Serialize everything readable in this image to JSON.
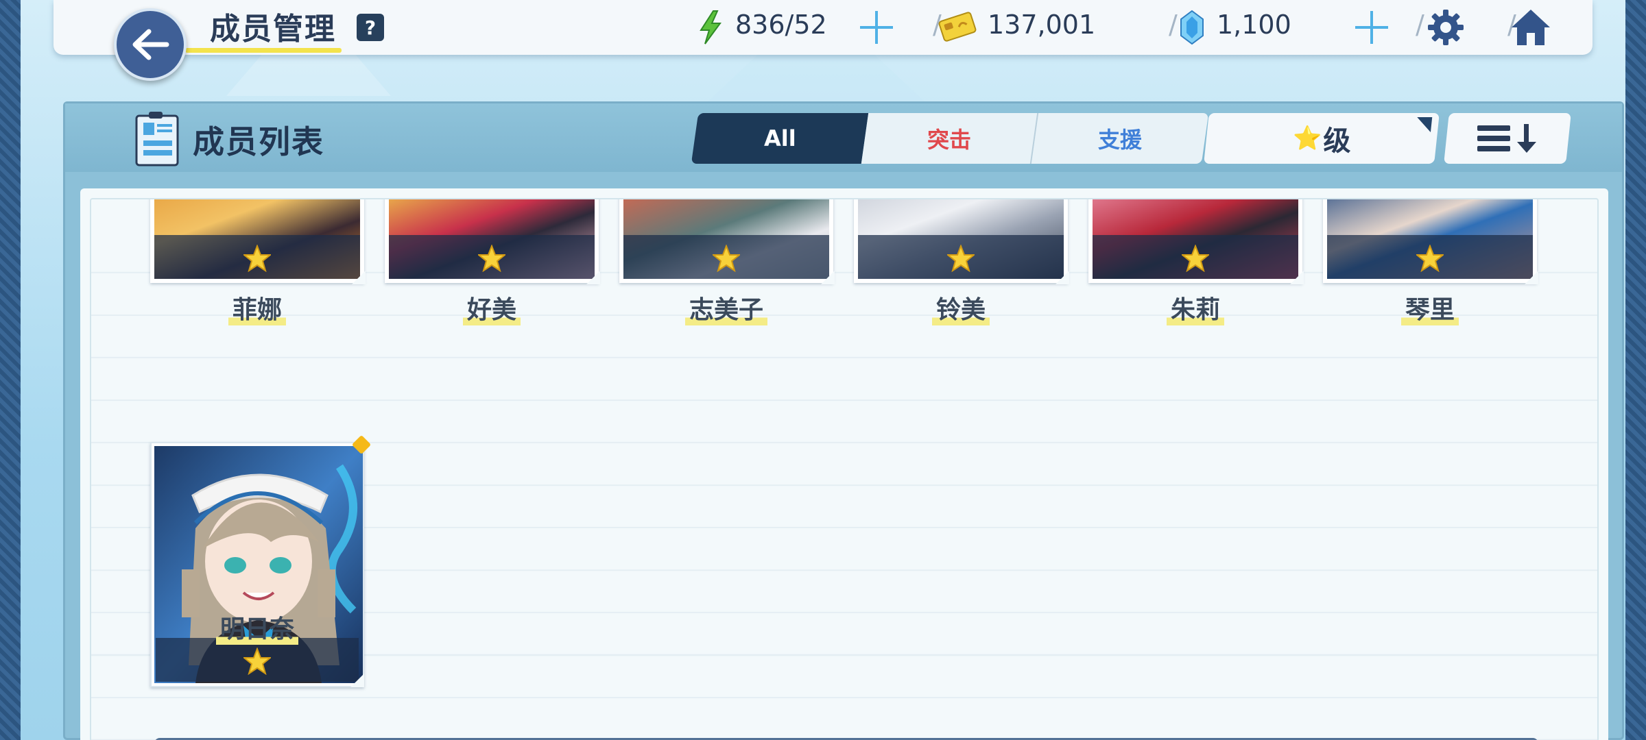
{
  "header": {
    "title": "成员管理",
    "help_label": "?",
    "stamina": "836/52",
    "credits": "137,001",
    "gems": "1,100",
    "separator": "/"
  },
  "panel": {
    "title": "成员列表",
    "tabs": [
      {
        "label": "All",
        "selected": true
      },
      {
        "label": "突击",
        "selected": false
      },
      {
        "label": "支援",
        "selected": false
      }
    ],
    "sort_label": "级",
    "sort_star": "⭐"
  },
  "members": [
    {
      "name": "菲娜",
      "stars": 1
    },
    {
      "name": "好美",
      "stars": 1
    },
    {
      "name": "志美子",
      "stars": 1
    },
    {
      "name": "铃美",
      "stars": 1
    },
    {
      "name": "朱莉",
      "stars": 1
    },
    {
      "name": "琴里",
      "stars": 1
    },
    {
      "name": "明日奈",
      "stars": 1,
      "new": true
    }
  ],
  "colors": {
    "accent_dark": "#1c3957",
    "strike_red": "#e0484c",
    "support_blue": "#3f7fd8",
    "highlight_yellow": "#f3e34d"
  },
  "icons": [
    "back-arrow-icon",
    "help-icon",
    "stamina-bolt-icon",
    "credit-card-icon",
    "gem-icon",
    "plus-icon",
    "gear-icon",
    "home-icon",
    "member-list-icon",
    "star-icon",
    "sort-order-icon"
  ]
}
